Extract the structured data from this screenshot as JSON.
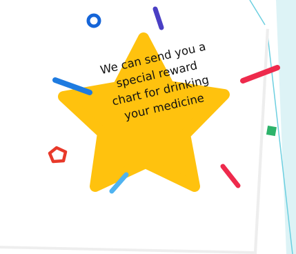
{
  "card": {
    "message": "We can send you a\nspecial reward\nchart for drinking\nyour medicine"
  },
  "colors": {
    "star": "#FFC20E",
    "blue_circle": "#1565D8",
    "purple_stroke": "#4A3FC4",
    "blue_stroke": "#1E7BE0",
    "red_stroke": "#EE2A4C",
    "red_pentagon": "#E8392A",
    "green_square": "#2DB36A",
    "light_blue_stroke": "#4FB3F0",
    "card_shadow": "#E6E6E6",
    "edge_line": "#6CCFE0",
    "edge_panel": "#DDF3F6"
  },
  "icons": [
    "star-icon",
    "circle-icon",
    "pentagon-icon",
    "square-icon",
    "confetti-stroke-icon"
  ]
}
